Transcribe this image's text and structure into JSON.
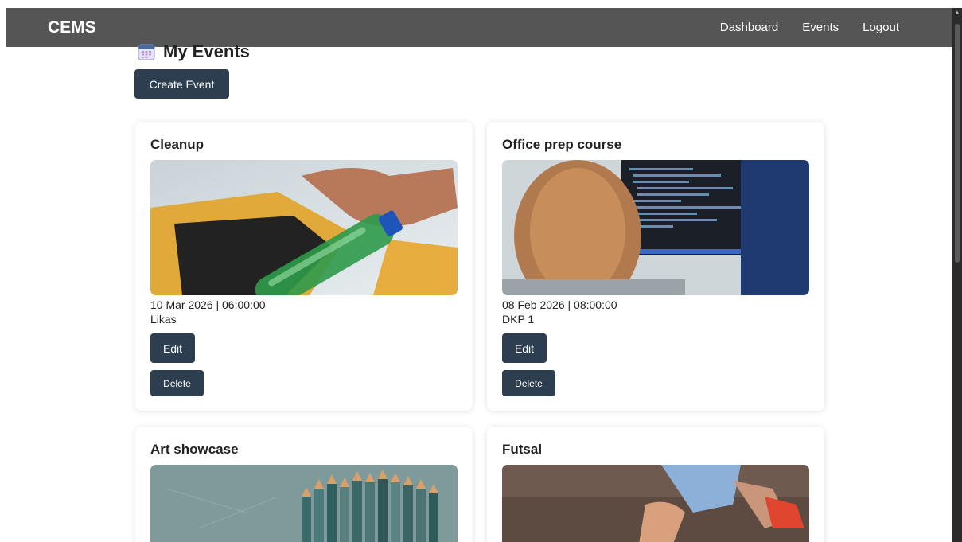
{
  "navbar": {
    "brand": "CEMS",
    "links": [
      "Dashboard",
      "Events",
      "Logout"
    ]
  },
  "page": {
    "title": "My Events",
    "create_label": "Create Event"
  },
  "events": [
    {
      "title": "Cleanup",
      "date": "10 Mar 2026 | 06:00:00",
      "venue": "Likas",
      "edit_label": "Edit",
      "delete_label": "Delete",
      "image": "recycling-bottle-photo"
    },
    {
      "title": "Office prep course",
      "date": "08 Feb 2026 | 08:00:00",
      "venue": "DKP 1",
      "edit_label": "Edit",
      "delete_label": "Delete",
      "image": "person-coding-photo"
    },
    {
      "title": "Art showcase",
      "image": "colored-pencils-photo"
    },
    {
      "title": "Futsal",
      "image": "futsal-player-photo"
    }
  ],
  "colors": {
    "navbar": "#555555",
    "button": "#2c3e50"
  }
}
